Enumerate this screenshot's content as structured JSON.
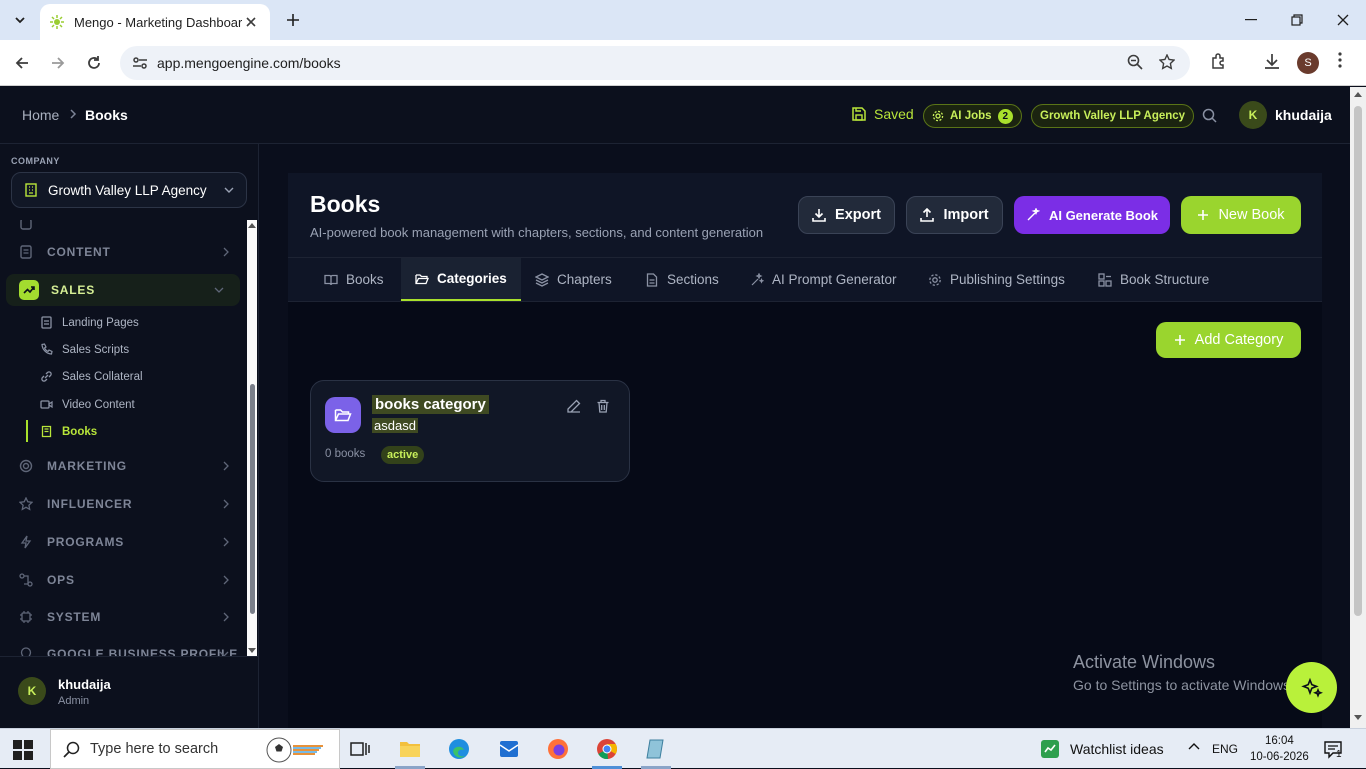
{
  "browser": {
    "tab_title": "Mengo - Marketing Dashboard",
    "url": "app.mengoengine.com/books",
    "profile_initial": "S"
  },
  "topbar": {
    "breadcrumb_home": "Home",
    "breadcrumb_current": "Books",
    "saved": "Saved",
    "ai_jobs": "AI Jobs",
    "ai_jobs_count": "2",
    "agency_pill": "Growth Valley LLP Agency",
    "user_initial": "K",
    "user_name": "khudaija"
  },
  "sidebar": {
    "company_label": "COMPANY",
    "company_name": "Growth Valley LLP Agency",
    "sections": [
      {
        "label": "CONTENT"
      },
      {
        "label": "SALES"
      },
      {
        "label": "MARKETING"
      },
      {
        "label": "INFLUENCER"
      },
      {
        "label": "PROGRAMS"
      },
      {
        "label": "OPS"
      },
      {
        "label": "SYSTEM"
      },
      {
        "label": "GOOGLE BUSINESS PROFILE"
      }
    ],
    "sales_items": [
      {
        "label": "Landing Pages"
      },
      {
        "label": "Sales Scripts"
      },
      {
        "label": "Sales Collateral"
      },
      {
        "label": "Video Content"
      },
      {
        "label": "Books"
      }
    ],
    "footer": {
      "initial": "K",
      "name": "khudaija",
      "role": "Admin"
    }
  },
  "page": {
    "title": "Books",
    "subtitle": "AI-powered book management with chapters, sections, and content generation",
    "buttons": {
      "export": "Export",
      "import": "Import",
      "ai_generate": "AI Generate Book",
      "new_book": "New Book",
      "add_category": "Add Category"
    },
    "tabs": [
      {
        "label": "Books"
      },
      {
        "label": "Categories"
      },
      {
        "label": "Chapters"
      },
      {
        "label": "Sections"
      },
      {
        "label": "AI Prompt Generator"
      },
      {
        "label": "Publishing Settings"
      },
      {
        "label": "Book Structure"
      }
    ],
    "active_tab": "Categories",
    "category_card": {
      "title": "books category",
      "description": "asdasd",
      "count": "0 books",
      "status": "active"
    }
  },
  "watermark": {
    "line1": "Activate Windows",
    "line2": "Go to Settings to activate Windows."
  },
  "taskbar": {
    "search_placeholder": "Type here to search",
    "watchlist": "Watchlist ideas",
    "lang": "ENG",
    "time": "16:04",
    "date": "10-06-2026",
    "notif_count": "1"
  },
  "colors": {
    "accent": "#a9e12c",
    "purple": "#7b2ee6",
    "bg": "#0a0e1c"
  }
}
